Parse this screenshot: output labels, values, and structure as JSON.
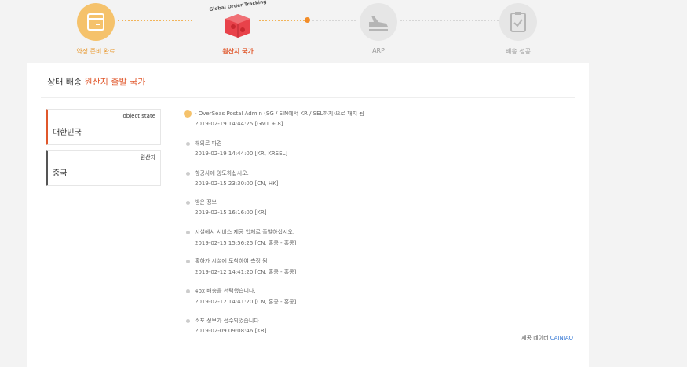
{
  "steps": [
    {
      "label": "약정 준비 완료",
      "icon": "box-icon",
      "status": "done"
    },
    {
      "label": "원산지 국가",
      "icon": "global-order-tracking-icon",
      "status": "current",
      "badge": "Global Order Tracking"
    },
    {
      "label": "ARP",
      "icon": "airplane-icon",
      "status": "pending"
    },
    {
      "label": "배송 성공",
      "icon": "clipboard-check-icon",
      "status": "pending"
    }
  ],
  "header": {
    "title_prefix": "상태 배송 ",
    "title_highlight": "원산지 출발 국가"
  },
  "info": [
    {
      "label": "object state",
      "value": "대한민국"
    },
    {
      "label": "원산지",
      "value": "중국"
    }
  ],
  "events": [
    {
      "desc": "- OverSeas Postal Admin (SG / SIN에서 KR / SEL까지)으로 패치 됨",
      "time": "2019-02-19 14:44:25 [GMT + 8]"
    },
    {
      "desc": "해외로 파견",
      "time": "2019-02-19 14:44:00 [KR, KRSEL]"
    },
    {
      "desc": "항공사에 양도하십시오.",
      "time": "2019-02-15 23:30:00 [CN, HK]"
    },
    {
      "desc": "받은 정보",
      "time": "2019-02-15 16:16:00 [KR]"
    },
    {
      "desc": "시설에서 서비스 제공 업체로 출발하십시오.",
      "time": "2019-02-15 15:56:25 [CN, 홍콩 - 홍콩]"
    },
    {
      "desc": "홍하가 시설에 도착하여 측정 됨",
      "time": "2019-02-12 14:41:20 [CN, 홍콩 - 홍콩]"
    },
    {
      "desc": "4px 배송을 선택했습니다.",
      "time": "2019-02-12 14:41:20 [CN, 홍콩 - 홍콩]"
    },
    {
      "desc": "소포 정보가 접수되었습니다.",
      "time": "2019-02-09 09:08:46 [KR]"
    }
  ],
  "provider": {
    "prefix": "제공 데이터 ",
    "name": "CAINIAO"
  },
  "colors": {
    "accent": "#e0572b",
    "done": "#f5c26b",
    "link": "#3a7bd5"
  }
}
